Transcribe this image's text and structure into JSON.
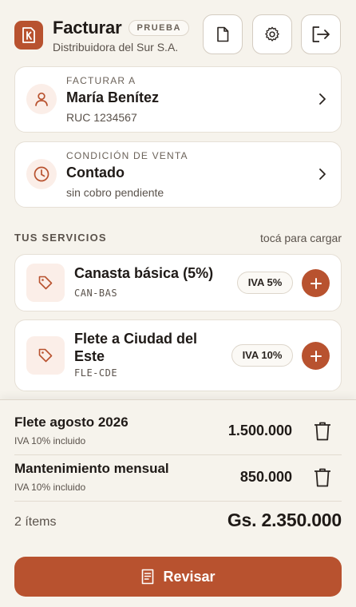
{
  "header": {
    "title": "Facturar",
    "badge": "PRUEBA",
    "company": "Distribuidora del Sur S.A.",
    "logo_icon": "invoice-k-icon",
    "buttons": [
      "document-icon",
      "gear-icon",
      "logout-icon"
    ]
  },
  "client_card": {
    "label": "FACTURAR A",
    "name": "María Benítez",
    "ruc": "RUC 1234567",
    "icon": "person-icon"
  },
  "sale_card": {
    "label": "CONDICIÓN DE VENTA",
    "value": "Contado",
    "sub": "sin cobro pendiente",
    "icon": "clock-icon"
  },
  "services": {
    "title": "TUS SERVICIOS",
    "hint": "tocá para cargar",
    "items": [
      {
        "name": "Canasta básica (5%)",
        "code": "CAN-BAS",
        "iva": "IVA 5%"
      },
      {
        "name_line1": "Flete a Ciudad del",
        "name_line2": "Este",
        "code": "FLE-CDE",
        "iva": "IVA 10%"
      }
    ]
  },
  "lines": [
    {
      "name": "Flete agosto 2026",
      "note": "IVA 10% incluido",
      "amount": "1.500.000"
    },
    {
      "name": "Mantenimiento mensual",
      "note": "IVA 10% incluido",
      "amount": "850.000"
    }
  ],
  "totals": {
    "count": "2 ítems",
    "amount": "Gs. 2.350.000"
  },
  "review_button": {
    "label": "Revisar",
    "icon": "receipt-icon"
  },
  "colors": {
    "accent": "#b8522f",
    "accent_soft": "#fbeee8",
    "background": "#f6f3ec"
  }
}
